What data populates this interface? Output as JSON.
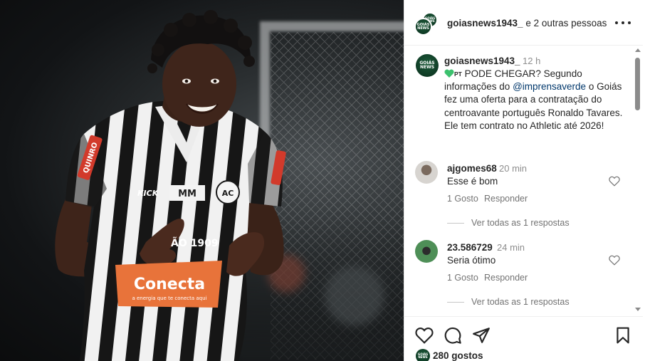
{
  "post": {
    "image_alt": "Jogador com camisa listrada preta e branca sorrindo",
    "jersey": {
      "sponsor_sleeve": "QUINRO",
      "sponsor_brand": "KICK",
      "sponsor_chest": "MM",
      "sponsor_main": "Conecta",
      "sponsor_sub": "a energia que te conecta aqui",
      "club_badge": "AC",
      "number_text": "ÃO 1909"
    }
  },
  "header": {
    "username": "goiasnews1943_",
    "collab_text": " e 2 outras pessoas",
    "logo_text": "GOIÁS NEWS"
  },
  "caption": {
    "username": "goiasnews1943_",
    "time": "12 h",
    "flag": "PT",
    "text_before": " PODE CHEGAR? Segundo informações do ",
    "mention": "@imprensaverde",
    "text_after": " o Goiás fez uma oferta para a contratação do centroavante português Ronaldo Tavares. Ele tem contrato no Athletic até 2026!"
  },
  "comments": [
    {
      "username": "ajgomes68",
      "time": "20 min",
      "text": "Esse é bom",
      "likes": "1 Gosto",
      "reply": "Responder",
      "view_replies": "Ver todas as 1 respostas"
    },
    {
      "username": "23.586729",
      "time": "24 min",
      "text": "Seria ótimo",
      "likes": "1 Gosto",
      "reply": "Responder",
      "view_replies": "Ver todas as 1 respostas"
    }
  ],
  "footer": {
    "likes": "280 gostos"
  },
  "colors": {
    "text": "#262626",
    "muted": "#8e8e8e",
    "mention": "#00376b",
    "heart_emoji": "#3cc16e",
    "logo": "#0f3b25"
  },
  "icons": [
    "more-icon",
    "heart-icon",
    "comment-icon",
    "share-icon",
    "bookmark-icon",
    "green-heart-icon"
  ]
}
